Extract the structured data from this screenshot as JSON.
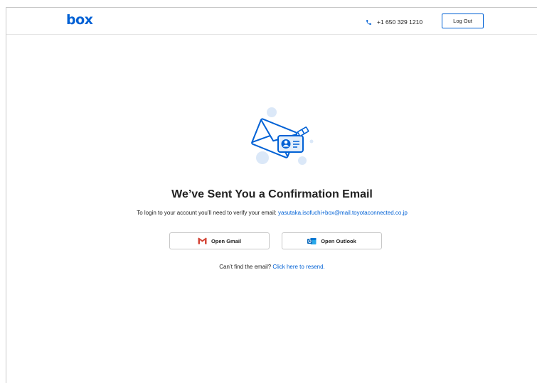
{
  "header": {
    "logo": "box",
    "phone": "+1 650 329 1210",
    "logout_label": "Log Out"
  },
  "main": {
    "title": "We’ve Sent You a Confirmation Email",
    "subtitle_prefix": "To login to your account you’ll need to verify your email: ",
    "email": "yasutaka.isofuchi+box@mail.toyotaconnected.co.jp",
    "gmail_label": "Open Gmail",
    "outlook_label": "Open Outlook",
    "resend_prefix": "Can’t find the email? ",
    "resend_link": "Click here to resend."
  },
  "icons": {
    "phone": "phone-icon",
    "gmail": "gmail-icon",
    "outlook": "outlook-icon",
    "illustration": "email-envelope-illustration"
  },
  "colors": {
    "brand": "#0061d5",
    "accent_light": "#dbe8f8",
    "gmail_red": "#d44638",
    "outlook_blue": "#0f6cbd"
  }
}
